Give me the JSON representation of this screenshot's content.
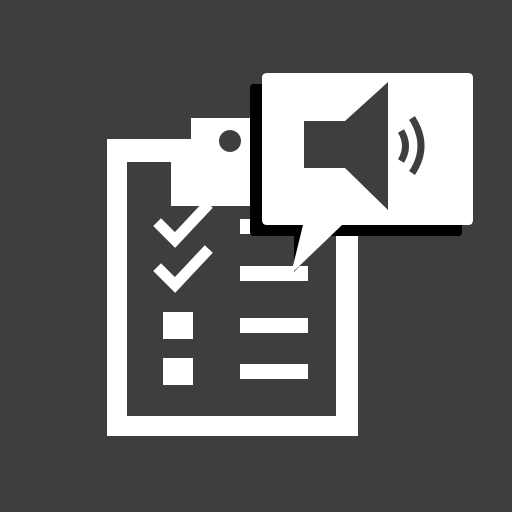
{
  "icon": {
    "background_color": "#3f3e3e",
    "foreground_color": "#ffffff",
    "shadow_color": "#000000",
    "parts": {
      "clipboard": "clipboard-icon",
      "checklist": "checklist-icon",
      "speech_bubble": "speech-bubble-icon",
      "speaker": "speaker-icon",
      "sound_waves": "sound-waves-icon"
    },
    "checklist_items": [
      {
        "state": "checked"
      },
      {
        "state": "checked"
      },
      {
        "state": "unchecked"
      },
      {
        "state": "unchecked"
      }
    ]
  }
}
